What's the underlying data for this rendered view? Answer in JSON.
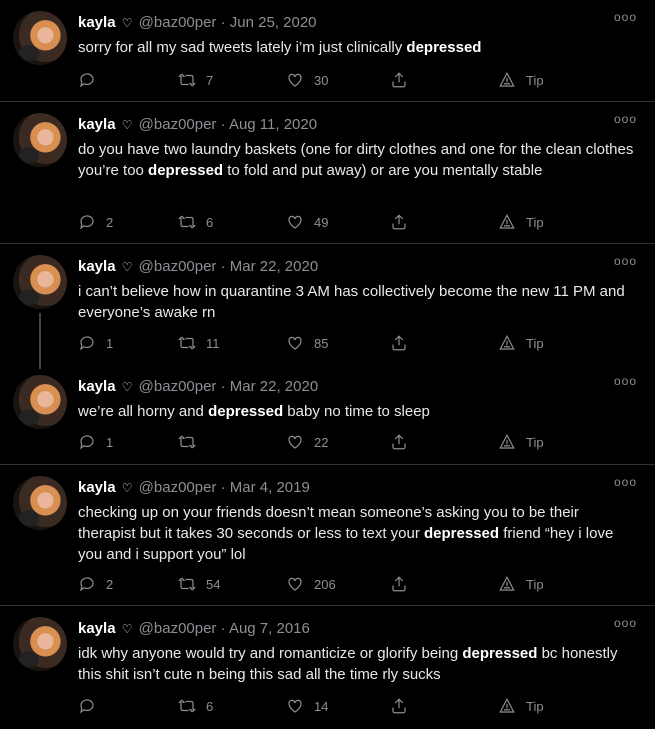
{
  "user": {
    "name": "kayla",
    "badge": "♡",
    "handle": "@baz00per"
  },
  "labels": {
    "tip": "Tip",
    "more": "ooo"
  },
  "tweets": [
    {
      "date": "· Jun 25, 2020",
      "before": "sorry for all my sad tweets lately  i’m just clinically ",
      "bold": "depressed",
      "after": "",
      "replies": "",
      "retweets": "7",
      "likes": "30"
    },
    {
      "date": "· Aug 11, 2020",
      "before": "do you have two laundry baskets (one for dirty clothes and one for the clean clothes you’re too ",
      "bold": "depressed",
      "after": " to fold and put away) or are you mentally stable",
      "replies": "2",
      "retweets": "6",
      "likes": "49"
    },
    {
      "date": "· Mar 22, 2020",
      "before": "i can’t believe how in quarantine 3 AM has collectively become the new 11 PM and everyone’s awake rn",
      "bold": "",
      "after": "",
      "replies": "1",
      "retweets": "11",
      "likes": "85"
    },
    {
      "date": "· Mar 22, 2020",
      "before": "we’re all horny and ",
      "bold": "depressed",
      "after": " baby no time to sleep",
      "replies": "1",
      "retweets": "",
      "likes": "22"
    },
    {
      "date": "· Mar 4, 2019",
      "before": "checking up on your friends doesn’t mean someone’s asking you to be their therapist but it takes 30 seconds or less to text your ",
      "bold": "depressed",
      "after": " friend “hey i love you and i support you” lol",
      "replies": "2",
      "retweets": "54",
      "likes": "206"
    },
    {
      "date": "· Aug 7, 2016",
      "before": "idk why anyone would try and romanticize or glorify being ",
      "bold": "depressed",
      "after": " bc honestly this shit isn’t cute n being this sad all the time rly sucks",
      "replies": "",
      "retweets": "6",
      "likes": "14"
    }
  ]
}
